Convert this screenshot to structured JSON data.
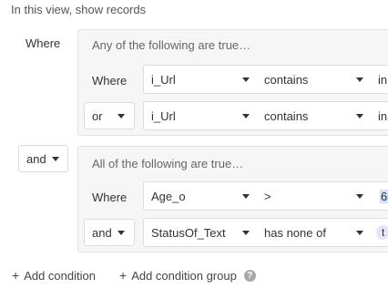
{
  "header": "In this view, show records",
  "top_conjunction": "Where",
  "groups": [
    {
      "title": "Any of the following are true…",
      "conditions": [
        {
          "prefix": "Where",
          "field": "i_Url",
          "operator": "contains",
          "value": "in"
        },
        {
          "prefix": "or",
          "field": "i_Url",
          "operator": "contains",
          "value": "in"
        }
      ]
    },
    {
      "conjunction": "and",
      "title": "All of the following are true…",
      "conditions": [
        {
          "prefix": "Where",
          "field": "Age_o",
          "operator": ">",
          "value": "6"
        },
        {
          "prefix": "and",
          "field": "StatusOf_Text",
          "operator": "has none of",
          "value": "t"
        }
      ]
    }
  ],
  "footer": {
    "add_condition": "Add condition",
    "add_group": "Add condition group",
    "help": "?"
  }
}
